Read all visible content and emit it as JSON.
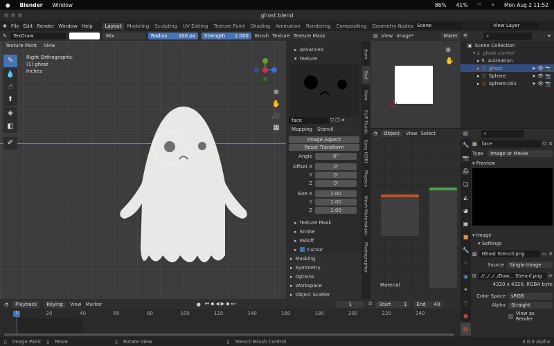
{
  "macos": {
    "apple": "",
    "app": "Blender",
    "menu": "Window",
    "battery_percent": "41%",
    "cpu": "86%",
    "datetime": "Mon Aug 2  11:52"
  },
  "window": {
    "title": "ghost.blend"
  },
  "topbar": {
    "menus": [
      "File",
      "Edit",
      "Render",
      "Window",
      "Help"
    ],
    "workspaces": [
      "Layout",
      "Modeling",
      "Sculpting",
      "UV Editing",
      "Texture Paint",
      "Shading",
      "Animation",
      "Rendering",
      "Compositing",
      "Geometry Nodes"
    ],
    "active_workspace": "Layout",
    "scene": "Scene",
    "view_layer": "View Layer"
  },
  "toolheader": {
    "brush": "TexDraw",
    "blend": "Mix",
    "radius_label": "Radius",
    "radius_value": "100 px",
    "strength_label": "Strength",
    "strength_value": "1.000",
    "menus": [
      "Brush",
      "Texture",
      "Texture Mask"
    ]
  },
  "viewport": {
    "mode": "Texture Paint",
    "view_menu": "View",
    "overlay": [
      "Right Orthographic",
      "(1) ghost",
      "Inches"
    ]
  },
  "npanel": {
    "sections_top": [
      "Advanced",
      "Texture"
    ],
    "texture_name": "face",
    "mapping_label": "Mapping",
    "mapping_value": "Stencil",
    "image_aspect": "Image Aspect",
    "reset_transform": "Reset Transform",
    "props": [
      {
        "label": "Angle",
        "value": "0°"
      },
      {
        "label": "Offset X",
        "value": "0'"
      },
      {
        "label": "Y",
        "value": "0'"
      },
      {
        "label": "Z",
        "value": "0'"
      },
      {
        "label": "Size X",
        "value": "1.00"
      },
      {
        "label": "Y",
        "value": "1.00"
      },
      {
        "label": "Z",
        "value": "1.00"
      }
    ],
    "subsections": [
      "Texture Mask",
      "Stroke",
      "Falloff",
      "Cursor"
    ],
    "sections": [
      "Masking",
      "Symmetry",
      "Options",
      "Workspace",
      "Object Scatter"
    ]
  },
  "vtabs": [
    "Item",
    "Tool",
    "View",
    "FLIP Fluids",
    "Easy HDRI",
    "Physics",
    "Mesh Materializer",
    "Photographer"
  ],
  "imageeditor": {
    "menus": [
      "View",
      "Image*"
    ],
    "material": "Mater"
  },
  "nodeeditor": {
    "mode": "Object",
    "menus": [
      "View",
      "Select"
    ],
    "label": "Material"
  },
  "outliner": {
    "items": [
      {
        "name": "Scene Collection"
      },
      {
        "name": "ghost control"
      },
      {
        "name": "Animation"
      },
      {
        "name": "ghost"
      },
      {
        "name": "Sphere"
      },
      {
        "name": "Sphere.001"
      }
    ]
  },
  "properties": {
    "texture_name": "face",
    "type_label": "Type",
    "type_value": "Image or Movie",
    "preview": "Preview",
    "image": "Image",
    "settings": "Settings",
    "image_name": "Ghost Stencil.png",
    "source_label": "Source",
    "source_value": "Single Image",
    "filepath": "//../../../Dow... Stencil.png",
    "resolution": "4320 x 4320,  RGBA byte",
    "colorspace_label": "Color Space",
    "colorspace_value": "sRGB",
    "alpha_label": "Alpha",
    "alpha_value": "Straight",
    "view_as_render": "View as Render"
  },
  "timeline": {
    "menus": [
      "Playback",
      "Keying",
      "View",
      "Marker"
    ],
    "current_frame": "1",
    "start_label": "Start",
    "start": "1",
    "end_label": "End",
    "end": "40",
    "ticks": [
      "20",
      "40",
      "60",
      "80",
      "100",
      "120",
      "140",
      "160",
      "180",
      "200",
      "220",
      "240"
    ],
    "playhead": "1"
  },
  "status": {
    "items": [
      "Image Paint",
      "Move",
      "Rotate View",
      "Stencil Brush Control"
    ],
    "version": "3.0.0 Alpha"
  },
  "colors": {
    "accent": "#4772b3",
    "grid_green": "#6a9a2a"
  }
}
